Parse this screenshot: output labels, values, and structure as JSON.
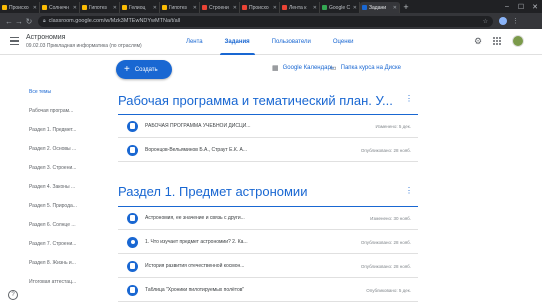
{
  "browser": {
    "tabs": [
      {
        "label": "Происхо",
        "color": "#fbbc04"
      },
      {
        "label": "Солнечн",
        "color": "#fbbc04"
      },
      {
        "label": "Гипотез",
        "color": "#fbbc04"
      },
      {
        "label": "Гелиоц",
        "color": "#fbbc04"
      },
      {
        "label": "Гипотез",
        "color": "#fbbc04"
      },
      {
        "label": "Строени",
        "color": "#ea4335"
      },
      {
        "label": "Происхо",
        "color": "#ea4335"
      },
      {
        "label": "Лента к",
        "color": "#ea4335"
      },
      {
        "label": "Google C",
        "color": "#34a853"
      },
      {
        "label": "Задани",
        "color": "#1967d2",
        "active": true
      }
    ],
    "url": "classroom.google.com/w/Mzk3MTEwNDYwMTNa/t/all"
  },
  "header": {
    "course_title": "Астрономия",
    "course_subtitle": "09.02.03 Прикладная информатика (по отраслям)",
    "tabs": [
      {
        "label": "Лента",
        "active": false
      },
      {
        "label": "Задания",
        "active": true
      },
      {
        "label": "Пользователи",
        "active": false
      },
      {
        "label": "Оценки",
        "active": false
      }
    ]
  },
  "sidebar": {
    "items": [
      {
        "label": "Все темы",
        "active": true
      },
      {
        "label": "Рабочая програм...",
        "active": false
      },
      {
        "label": "Раздел 1. Предмет...",
        "active": false
      },
      {
        "label": "Раздел 2. Основы ...",
        "active": false
      },
      {
        "label": "Раздел 3. Строени...",
        "active": false
      },
      {
        "label": "Раздел 4. Законы ...",
        "active": false
      },
      {
        "label": "Раздел 5. Природа...",
        "active": false
      },
      {
        "label": "Раздел 6. Солнце ...",
        "active": false
      },
      {
        "label": "Раздел 7. Строени...",
        "active": false
      },
      {
        "label": "Раздел 8. Жизнь и...",
        "active": false
      },
      {
        "label": "Итоговая аттестац...",
        "active": false
      }
    ]
  },
  "toolbar": {
    "create_label": "Создать",
    "calendar_label": "Google Календарь",
    "drive_label": "Папка курса на Диске"
  },
  "sections": [
    {
      "title": "Рабочая программа и тематический план. У...",
      "rows": [
        {
          "icon": "assignment-icon",
          "text": "РАБОЧАЯ ПРОГРАММА УЧЕБНОЙ ДИСЦИ...",
          "date": "Изменено: 5 дек."
        },
        {
          "icon": "assignment-icon",
          "text": "Воронцов-Вельяминов Б.А., Страут Е.К. А...",
          "date": "Опубликовано: 28 нояб."
        }
      ]
    },
    {
      "title": "Раздел 1. Предмет астрономии",
      "rows": [
        {
          "icon": "assignment-icon",
          "text": "Астрономия, ее значение и связь с други...",
          "date": "Изменено: 30 нояб."
        },
        {
          "icon": "question-icon",
          "text": "1. Что изучает предмет астрономии? 2. Ка...",
          "date": "Опубликовано: 28 нояб."
        },
        {
          "icon": "assignment-icon",
          "text": "История развития отечественной космон...",
          "date": "Опубликовано: 28 нояб."
        },
        {
          "icon": "assignment-icon",
          "text": "Таблица \"Хроники пилотируемых полётов\"",
          "date": "Опубликовано: 5 дек."
        }
      ]
    }
  ]
}
